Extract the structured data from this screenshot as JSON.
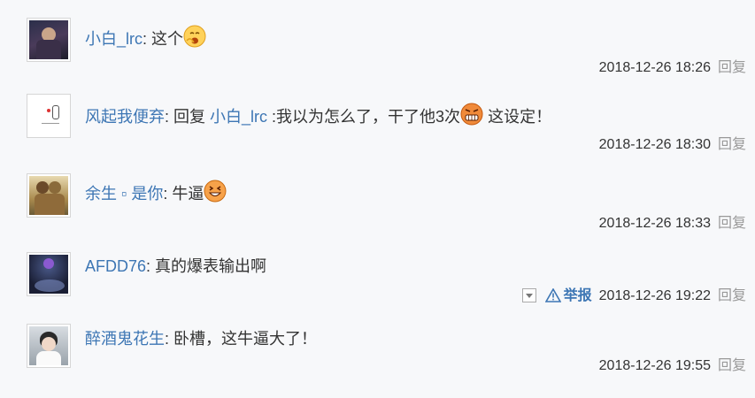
{
  "comments": [
    {
      "user": "小白_lrc",
      "separator": ": ",
      "text": "这个",
      "emoji": "yawn-face-emoji",
      "time": "2018-12-26 18:26",
      "reply_label": "回复"
    },
    {
      "user": "风起我便弃",
      "separator": ": ",
      "prefix": "回复 ",
      "reply_to": "小白_lrc",
      "text": " :我以为怎么了，干了他3次",
      "emoji": "angry-face-emoji",
      "text_after": " 这设定！",
      "time": "2018-12-26 18:30",
      "reply_label": "回复"
    },
    {
      "user": "余生 ▫ 是你",
      "separator": ": ",
      "text": "牛逼",
      "emoji": "grin-face-emoji",
      "time": "2018-12-26 18:33",
      "reply_label": "回复"
    },
    {
      "user": "AFDD76",
      "separator": ": ",
      "text": "真的爆表输出啊",
      "time": "2018-12-26 19:22",
      "report_label": "举报",
      "reply_label": "回复"
    },
    {
      "user": "醉酒鬼花生",
      "separator": ": ",
      "text": "卧槽，这牛逼大了！",
      "time": "2018-12-26 19:55",
      "reply_label": "回复"
    }
  ],
  "colors": {
    "link": "#3d76b4",
    "text": "#333333",
    "muted": "#999999",
    "background": "#f7f8fa"
  }
}
